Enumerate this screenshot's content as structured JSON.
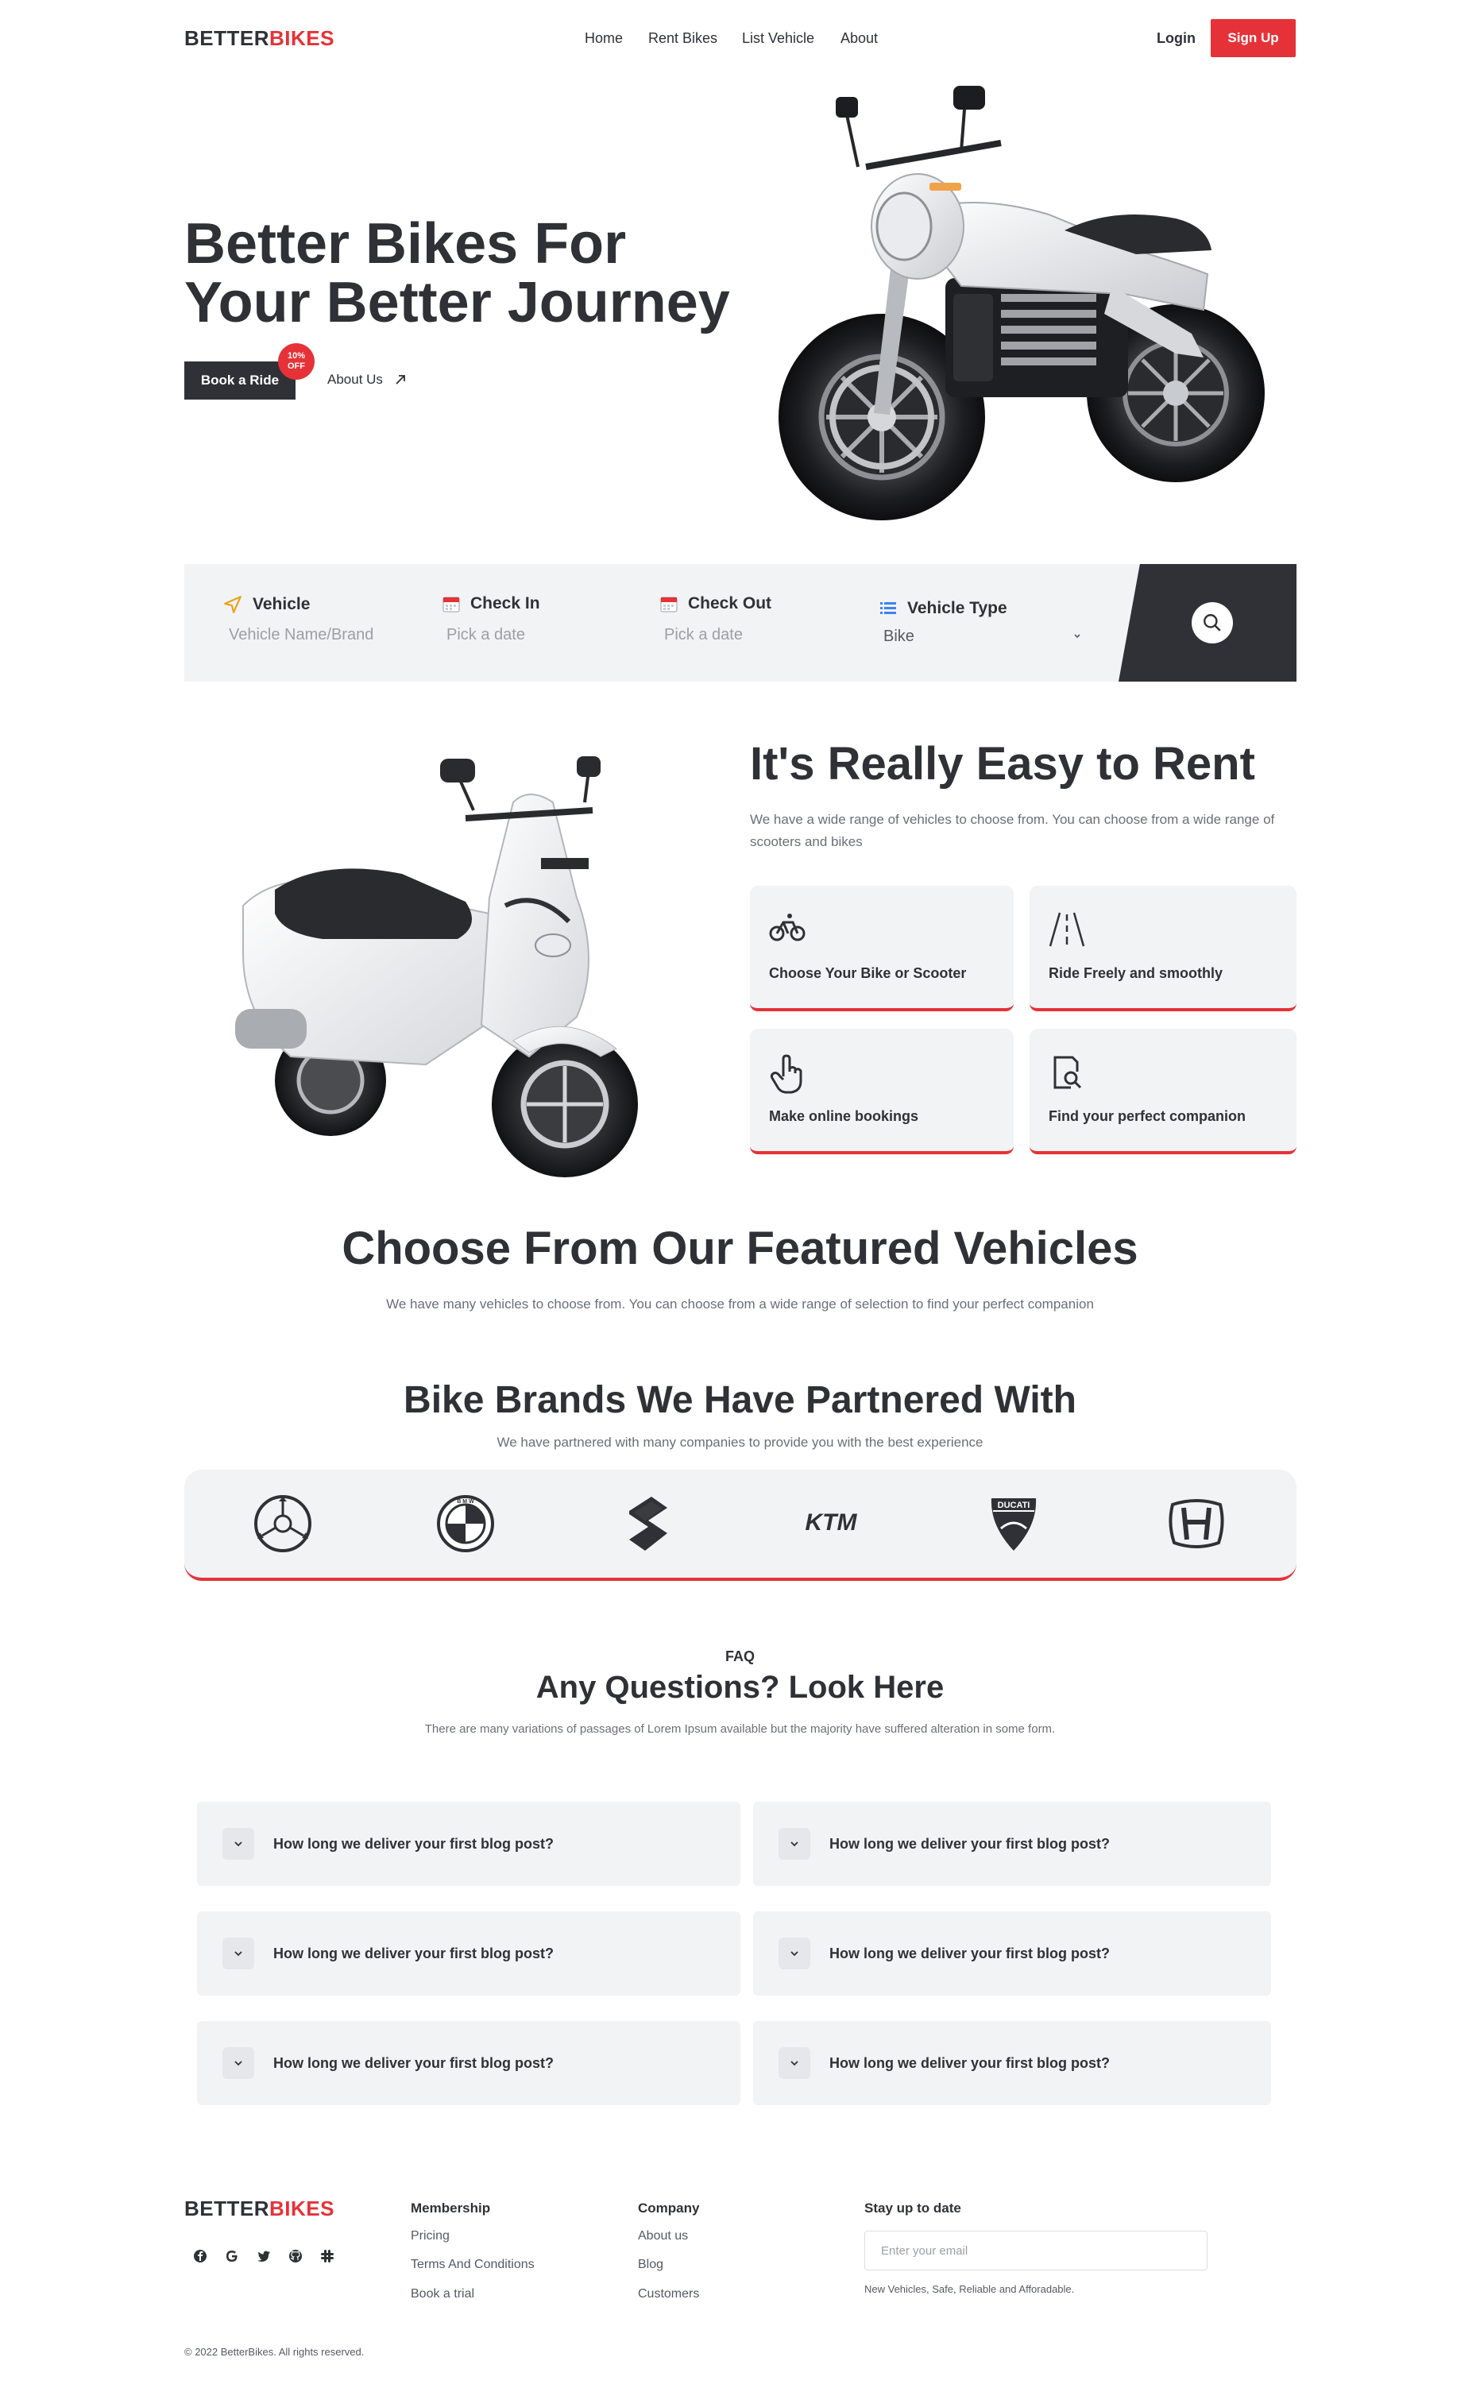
{
  "header": {
    "logo_part1": "BETTER",
    "logo_part2": "BIKES",
    "nav": [
      "Home",
      "Rent Bikes",
      "List Vehicle",
      "About"
    ],
    "login": "Login",
    "signup": "Sign Up"
  },
  "hero": {
    "title_line1": "Better Bikes For",
    "title_line2": "Your Better Journey",
    "book_button": "Book a Ride",
    "badge_line1": "10%",
    "badge_line2": "OFF",
    "about_link": "About Us"
  },
  "search": {
    "vehicle_label": "Vehicle",
    "vehicle_placeholder": "Vehicle Name/Brand",
    "checkin_label": "Check In",
    "checkin_placeholder": "Pick a date",
    "checkout_label": "Check Out",
    "checkout_placeholder": "Pick a date",
    "type_label": "Vehicle Type",
    "type_value": "Bike"
  },
  "easy_rent": {
    "title": "It's Really Easy to Rent",
    "description": "We have a wide range of vehicles to choose from. You can choose from a wide range of scooters and bikes",
    "features": [
      {
        "label": "Choose Your Bike or Scooter",
        "icon": "bicycle-icon"
      },
      {
        "label": "Ride Freely and smoothly",
        "icon": "road-icon"
      },
      {
        "label": "Make online bookings",
        "icon": "pointer-hand-icon"
      },
      {
        "label": "Find your perfect companion",
        "icon": "search-document-icon"
      }
    ]
  },
  "featured": {
    "title": "Choose From Our Featured Vehicles",
    "description": "We have many vehicles to choose from. You can choose from a wide range of selection to find your perfect companion"
  },
  "brands": {
    "title": "Bike Brands We Have Partnered With",
    "description": "We have partnered with many companies to provide you with the best experience",
    "logos": [
      "yamaha-logo",
      "bmw-logo",
      "suzuki-logo",
      "ktm-logo",
      "ducati-logo",
      "honda-logo"
    ],
    "bmw_text": "B M W",
    "ktm_text": "KTM",
    "ducati_text": "DUCATI"
  },
  "faq": {
    "eyebrow": "FAQ",
    "title": "Any Questions? Look Here",
    "description": "There are many variations of passages of Lorem Ipsum available but the majority have suffered alteration in some form.",
    "questions": [
      "How long we deliver your first blog post?",
      "How long we deliver your first blog post?",
      "How long we deliver your first blog post?",
      "How long we deliver your first blog post?",
      "How long we deliver your first blog post?",
      "How long we deliver your first blog post?"
    ]
  },
  "footer": {
    "logo_part1": "BETTER",
    "logo_part2": "BIKES",
    "social": [
      "facebook-icon",
      "google-icon",
      "twitter-icon",
      "github-icon",
      "slack-icon"
    ],
    "membership_title": "Membership",
    "membership_links": [
      "Pricing",
      "Terms And Conditions",
      "Book a trial"
    ],
    "company_title": "Company",
    "company_links": [
      "About us",
      "Blog",
      "Customers"
    ],
    "newsletter_title": "Stay up to date",
    "email_placeholder": "Enter your email",
    "newsletter_note": "New Vehicles, Safe, Reliable and Afforadable.",
    "copyright": "© 2022 BetterBikes. All rights reserved."
  },
  "colors": {
    "accent": "#e53238",
    "dark": "#2f3136",
    "panel": "#f2f3f5"
  }
}
